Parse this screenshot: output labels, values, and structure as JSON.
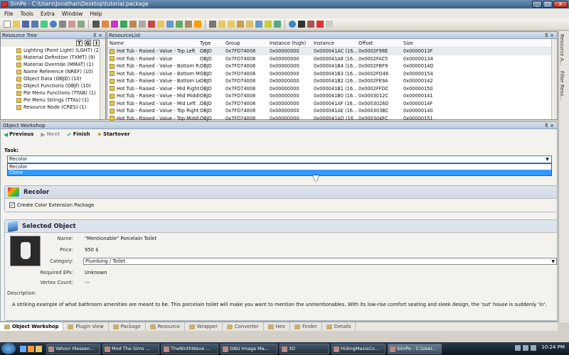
{
  "window": {
    "title": "SimPe - C:\\Users\\Jonathan\\Desktop\\tutorial.package",
    "min": "_",
    "max": "□",
    "close": "X"
  },
  "menu": [
    "File",
    "Tools",
    "Extra",
    "Window",
    "Help"
  ],
  "resource_tree": {
    "title": "Resource Tree",
    "pin": "⊼ ×",
    "btns": [
      "T",
      "G",
      "I"
    ],
    "items": [
      "Lighting (Point Light) (LGHT) (2)",
      "Material Definition (TXMT) (9)",
      "Material Override (MMAT) (1)",
      "Name Reference (NREF) (10)",
      "Object Data (OBJD) (10)",
      "Object Functions (OBJf) (10)",
      "Pie Menu Functions (TTAB) (1)",
      "Pie Menu Strings (TTAs) (1)",
      "Resource Node (CRES) (1)"
    ]
  },
  "resource_list": {
    "title": "ResourceList",
    "pin": "⊼ ×",
    "columns": [
      "Name",
      "Type",
      "Group",
      "Instance (high)",
      "Instance",
      "Offset",
      "Size"
    ],
    "rows": [
      [
        "Hot Tub - Raised - Value - Top Left",
        "OBJD",
        "0x7FD74008",
        "0x00000000",
        "0x000041AC (16...",
        "0x0002F98E",
        "0x0000013F"
      ],
      [
        "Hot Tub - Raised - Value",
        "OBJD",
        "0x7FD74008",
        "0x00000000",
        "0x000041A8 (16...",
        "0x0002FAC5",
        "0x00000134"
      ],
      [
        "Hot Tub - Raised - Value - Bottom R...",
        "OBJD",
        "0x7FD74008",
        "0x00000000",
        "0x000041B4 (16...",
        "0x0002FBF9",
        "0x0000014D"
      ],
      [
        "Hot Tub - Raised - Value - Bottom M...",
        "OBJD",
        "0x7FD74008",
        "0x00000000",
        "0x000041B3 (16...",
        "0x0002FD46",
        "0x00000154"
      ],
      [
        "Hot Tub - Raised - Value - Bottom Left",
        "OBJD",
        "0x7FD74008",
        "0x00000000",
        "0x000041B2 (16...",
        "0x0002FE9A",
        "0x00000142"
      ],
      [
        "Hot Tub - Raised - Value - Mid Right...",
        "OBJD",
        "0x7FD74008",
        "0x00000000",
        "0x000041B1 (16...",
        "0x0002FFDC",
        "0x00000150"
      ],
      [
        "Hot Tub - Raised - Value - Mid Middle",
        "OBJD",
        "0x7FD74008",
        "0x00000000",
        "0x000041B0 (16...",
        "0x0003012C",
        "0x00000141"
      ],
      [
        "Hot Tub - Raised - Value - Mid Left ...",
        "OBJD",
        "0x7FD74008",
        "0x00000000",
        "0x000041AF (16...",
        "0x0003026D",
        "0x0000014F"
      ],
      [
        "Hot Tub - Raised - Value - Top Right",
        "OBJD",
        "0x7FD74008",
        "0x00000000",
        "0x000041AE (16...",
        "0x000303BC",
        "0x00000140"
      ],
      [
        "Hot Tub - Raised - Value - Top Middl...",
        "OBJD",
        "0x7FD74008",
        "0x00000000",
        "0x000041AD (16...",
        "0x000304FC",
        "0x00000151"
      ]
    ]
  },
  "side_tabs": [
    "Resource A...",
    "Filter Reso..."
  ],
  "object_workshop": {
    "title": "Object Workshop",
    "pin": "⊼ ×",
    "nav": {
      "previous": "Previous",
      "next": "Next",
      "finish": "Finish",
      "startover": "Startover"
    },
    "task_label": "Task:",
    "task_value": "Recolor",
    "task_options": [
      "Recolor",
      "Clone"
    ],
    "recolor": {
      "title": "Recolor",
      "checkbox": "Create Color Extension Package",
      "checked": true
    },
    "selected": {
      "title": "Selected Object",
      "name_label": "Name:",
      "name": "\"Mentionable\" Porcelain Toilet",
      "price_label": "Price:",
      "price": "950 $",
      "category_label": "Category:",
      "category": "Plumbing / Toilet",
      "eps_label": "Required EPs:",
      "eps": "Unknown",
      "vertex_label": "Vertex Count:",
      "vertex": "---",
      "desc_label": "Description:",
      "description": "A striking example of what bathroom amenities are meant to be. This porcelain toilet will make you want to mention the unmentionables. With its low-rise comfort seating and sleek design, the 'out' house is suddenly 'in'."
    }
  },
  "bottom_tabs": [
    "Object Workshop",
    "Plugin View",
    "Package",
    "Resource",
    "Wrapper",
    "Converter",
    "Hex",
    "Finder",
    "Details"
  ],
  "taskbar": {
    "items": [
      "Yahoo! Messen...",
      "Mod The Sims ...",
      "TheNinthWave ...",
      "GNU Image Ma...",
      "3D",
      "HidingMaxisCo...",
      "SimPe - C:\\User..."
    ],
    "clock": "10:24 PM"
  }
}
